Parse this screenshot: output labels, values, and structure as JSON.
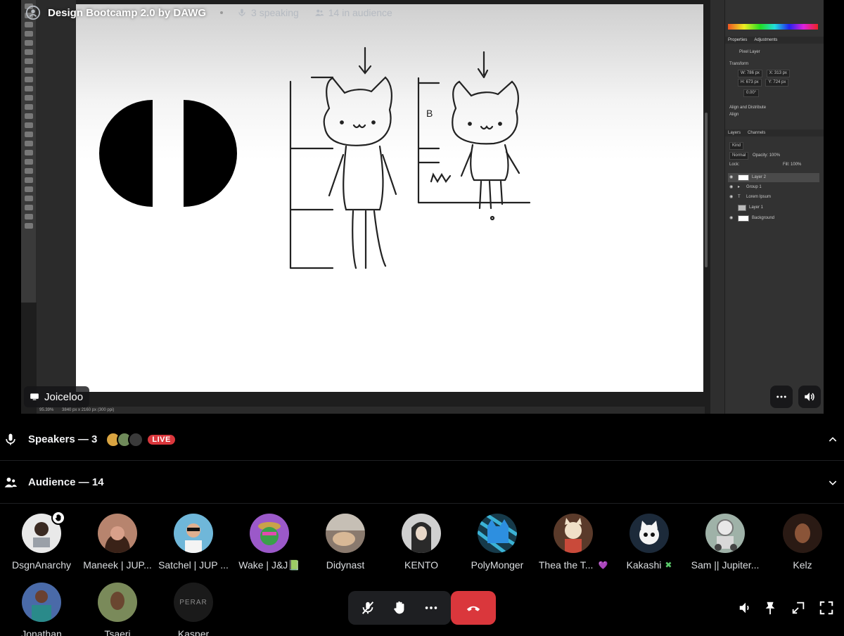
{
  "stage": {
    "title": "Design Bootcamp 2.0 by DAWG",
    "speaking": "3 speaking",
    "audience_count": "14 in audience",
    "presenter": "Joiceloo"
  },
  "photoshop": {
    "zoom": "95.39%",
    "doc_info": "3840 px x 2160 px (300 ppi)",
    "tabs": [
      "Properties",
      "Adjustments"
    ],
    "pixel_layer": "Pixel Layer",
    "transform_label": "Transform",
    "w": "W: 786 px",
    "x": "X: 313 px",
    "h": "H: 673 px",
    "y": "Y: 724 px",
    "angle": "0.00°",
    "align_label": "Align and Distribute",
    "align": "Align",
    "layer_tabs": [
      "Layers",
      "Channels"
    ],
    "kind": "Kind",
    "blend": "Normal",
    "opacity": "Opacity: 100%",
    "lock": "Lock:",
    "fill": "Fill: 100%",
    "layers": [
      "Layer 2",
      "Group 1",
      "Lorem Ipsum",
      "Layer 1",
      "Background"
    ],
    "canvas_letters": [
      "B",
      "M"
    ]
  },
  "speakers": {
    "title": "Speakers — 3",
    "live": "LIVE",
    "avatar_colors": [
      "#d9a441",
      "#6f8a5a",
      "#3a3a3a"
    ]
  },
  "audience": {
    "title": "Audience — 14",
    "members": [
      {
        "name": "DsgnAnarchy",
        "color": "#e9e9e9",
        "hand": true
      },
      {
        "name": "Maneek | JUP...",
        "color": "#b7846e"
      },
      {
        "name": "Satchel | JUP ...",
        "color": "#6fb7d9"
      },
      {
        "name": "Wake | J&J📗",
        "color": "#9b59c9"
      },
      {
        "name": "Didynast",
        "color": "#8a7a6e"
      },
      {
        "name": "KENTO",
        "color": "#cfcfcf"
      },
      {
        "name": "PolyMonger",
        "color": "#3bb3d6"
      },
      {
        "name": "Thea the T...",
        "color": "#c98b5a",
        "badge": "💜"
      },
      {
        "name": "Kakashi",
        "color": "#1c2a3a",
        "badge": "✖"
      },
      {
        "name": "Sam || Jupiter...",
        "color": "#9fb2a8"
      },
      {
        "name": "Kelz",
        "color": "#5a3424"
      },
      {
        "name": "Jonathan",
        "color": "#4a6aa8"
      },
      {
        "name": "Tsaeri",
        "color": "#7a8a5a"
      },
      {
        "name": "Kasper",
        "color": "#1a1a1a",
        "logo": "PERAR"
      }
    ]
  }
}
